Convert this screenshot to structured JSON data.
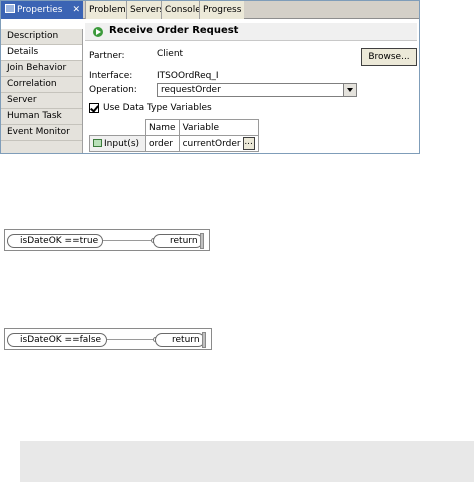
{
  "tabs": {
    "active": "Properties",
    "inactive": [
      "Problems",
      "Servers",
      "Console",
      "Progress"
    ]
  },
  "sidebar": {
    "items": [
      "Description",
      "Details",
      "Join Behavior",
      "Correlation",
      "Server",
      "Human Task",
      "Event Monitor"
    ],
    "selected": "Details"
  },
  "details": {
    "title": "Receive Order Request",
    "partner_label": "Partner:",
    "partner_value": "Client",
    "browse_label": "Browse...",
    "interface_label": "Interface:",
    "interface_value": "ITSOOrdReq_I",
    "operation_label": "Operation:",
    "operation_value": "requestOrder",
    "use_dt_label": "Use Data Type Variables",
    "use_dt_checked": true,
    "table": {
      "col_name": "Name",
      "col_variable": "Variable",
      "row_label": "Input(s)",
      "row_name": "order",
      "row_variable": "currentOrder",
      "dots": "..."
    }
  },
  "flows": [
    {
      "condition": "isDateOK ==true",
      "end": "return"
    },
    {
      "condition": "isDateOK ==false",
      "end": "return"
    }
  ],
  "colors": {
    "active_tab": "#3b64b4",
    "tab_bar": "#d4d0c8",
    "start_icon": "#3c9a3c"
  }
}
